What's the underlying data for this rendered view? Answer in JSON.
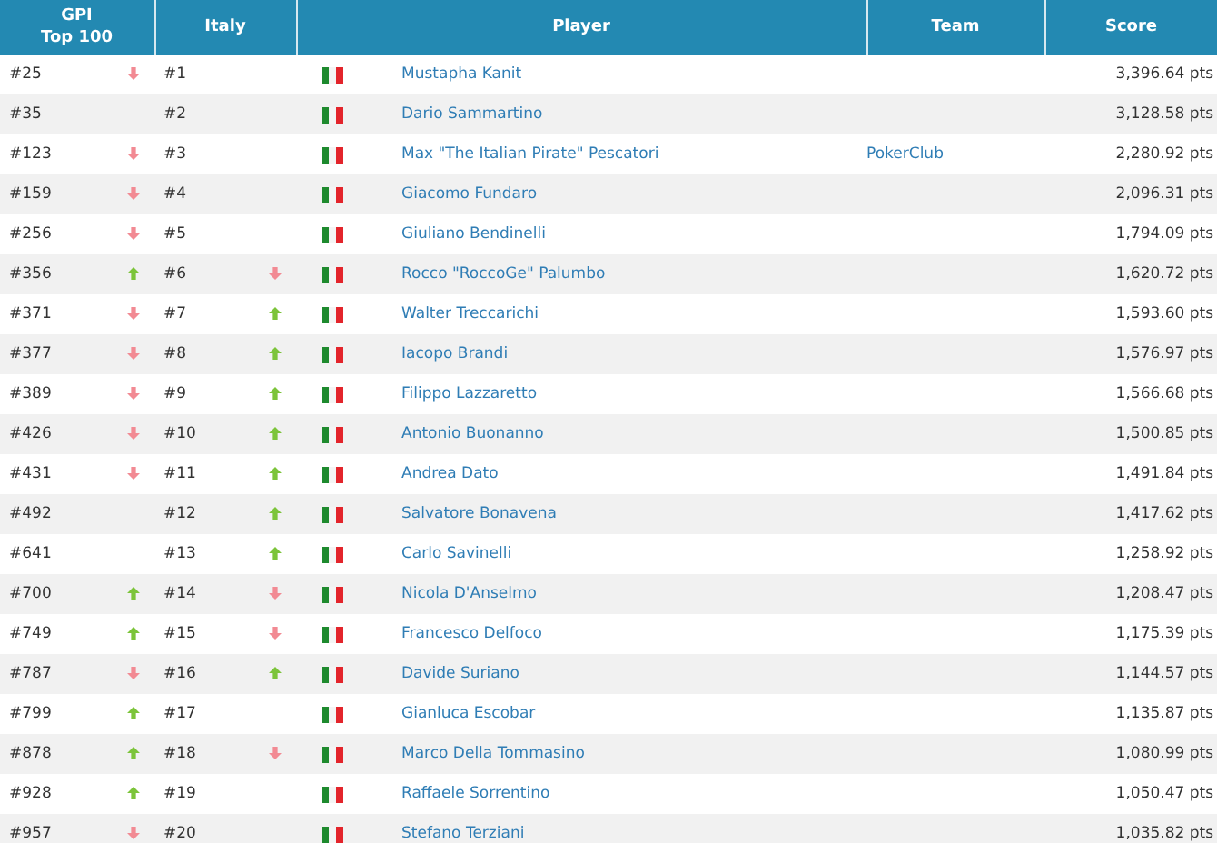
{
  "table": {
    "columns": [
      {
        "label": "GPI\nTop 100"
      },
      {
        "label": "Italy"
      },
      {
        "label": "Player"
      },
      {
        "label": "Team"
      },
      {
        "label": "Score"
      }
    ],
    "rows": [
      {
        "gpi_rank": "#25",
        "gpi_up": false,
        "gpi_down": true,
        "italy_rank": "#1",
        "italy_up": false,
        "italy_down": false,
        "player": "Mustapha Kanit",
        "score": "3,396.64 pts"
      },
      {
        "gpi_rank": "#35",
        "gpi_up": false,
        "gpi_down": false,
        "italy_rank": "#2",
        "italy_up": false,
        "italy_down": false,
        "player": "Dario Sammartino",
        "score": "3,128.58 pts"
      },
      {
        "gpi_rank": "#123",
        "gpi_up": false,
        "gpi_down": true,
        "italy_rank": "#3",
        "italy_up": false,
        "italy_down": false,
        "player": "Max \"The Italian Pirate\" Pescatori",
        "team": "PokerClub",
        "score": "2,280.92 pts"
      },
      {
        "gpi_rank": "#159",
        "gpi_up": false,
        "gpi_down": true,
        "italy_rank": "#4",
        "italy_up": false,
        "italy_down": false,
        "player": "Giacomo Fundaro",
        "score": "2,096.31 pts"
      },
      {
        "gpi_rank": "#256",
        "gpi_up": false,
        "gpi_down": true,
        "italy_rank": "#5",
        "italy_up": false,
        "italy_down": false,
        "player": "Giuliano Bendinelli",
        "score": "1,794.09 pts"
      },
      {
        "gpi_rank": "#356",
        "gpi_up": true,
        "gpi_down": false,
        "italy_rank": "#6",
        "italy_up": false,
        "italy_down": true,
        "player": "Rocco \"RoccoGe\" Palumbo",
        "score": "1,620.72 pts"
      },
      {
        "gpi_rank": "#371",
        "gpi_up": false,
        "gpi_down": true,
        "italy_rank": "#7",
        "italy_up": true,
        "italy_down": false,
        "player": "Walter Treccarichi",
        "score": "1,593.60 pts"
      },
      {
        "gpi_rank": "#377",
        "gpi_up": false,
        "gpi_down": true,
        "italy_rank": "#8",
        "italy_up": true,
        "italy_down": false,
        "player": "Iacopo Brandi",
        "score": "1,576.97 pts"
      },
      {
        "gpi_rank": "#389",
        "gpi_up": false,
        "gpi_down": true,
        "italy_rank": "#9",
        "italy_up": true,
        "italy_down": false,
        "player": "Filippo Lazzaretto",
        "score": "1,566.68 pts"
      },
      {
        "gpi_rank": "#426",
        "gpi_up": false,
        "gpi_down": true,
        "italy_rank": "#10",
        "italy_up": true,
        "italy_down": false,
        "player": "Antonio Buonanno",
        "score": "1,500.85 pts"
      },
      {
        "gpi_rank": "#431",
        "gpi_up": false,
        "gpi_down": true,
        "italy_rank": "#11",
        "italy_up": true,
        "italy_down": false,
        "player": "Andrea Dato",
        "score": "1,491.84 pts"
      },
      {
        "gpi_rank": "#492",
        "gpi_up": false,
        "gpi_down": false,
        "italy_rank": "#12",
        "italy_up": true,
        "italy_down": false,
        "player": "Salvatore Bonavena",
        "score": "1,417.62 pts"
      },
      {
        "gpi_rank": "#641",
        "gpi_up": false,
        "gpi_down": false,
        "italy_rank": "#13",
        "italy_up": true,
        "italy_down": false,
        "player": "Carlo Savinelli",
        "score": "1,258.92 pts"
      },
      {
        "gpi_rank": "#700",
        "gpi_up": true,
        "gpi_down": false,
        "italy_rank": "#14",
        "italy_up": false,
        "italy_down": true,
        "player": "Nicola D'Anselmo",
        "score": "1,208.47 pts"
      },
      {
        "gpi_rank": "#749",
        "gpi_up": true,
        "gpi_down": false,
        "italy_rank": "#15",
        "italy_up": false,
        "italy_down": true,
        "player": "Francesco Delfoco",
        "score": "1,175.39 pts"
      },
      {
        "gpi_rank": "#787",
        "gpi_up": false,
        "gpi_down": true,
        "italy_rank": "#16",
        "italy_up": true,
        "italy_down": false,
        "player": "Davide Suriano",
        "score": "1,144.57 pts"
      },
      {
        "gpi_rank": "#799",
        "gpi_up": true,
        "gpi_down": false,
        "italy_rank": "#17",
        "italy_up": false,
        "italy_down": false,
        "player": "Gianluca Escobar",
        "score": "1,135.87 pts"
      },
      {
        "gpi_rank": "#878",
        "gpi_up": true,
        "gpi_down": false,
        "italy_rank": "#18",
        "italy_up": false,
        "italy_down": true,
        "player": "Marco Della Tommasino",
        "score": "1,080.99 pts"
      },
      {
        "gpi_rank": "#928",
        "gpi_up": true,
        "gpi_down": false,
        "italy_rank": "#19",
        "italy_up": false,
        "italy_down": false,
        "player": "Raffaele Sorrentino",
        "score": "1,050.47 pts"
      },
      {
        "gpi_rank": "#957",
        "gpi_up": false,
        "gpi_down": true,
        "italy_rank": "#20",
        "italy_up": false,
        "italy_down": false,
        "player": "Stefano Terziani",
        "score": "1,035.82 pts"
      }
    ]
  }
}
